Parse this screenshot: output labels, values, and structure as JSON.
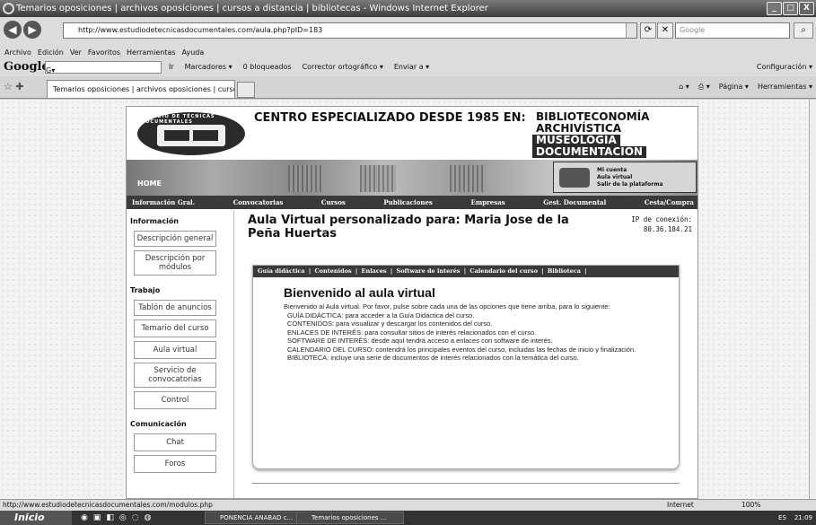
{
  "window": {
    "title": "Temarios oposiciones | archivos oposiciones | cursos a distancia | bibliotecas - Windows Internet Explorer",
    "btn_min": "_",
    "btn_max": "□",
    "btn_close": "X"
  },
  "address": {
    "url": "http://www.estudiodetecnicasdocumentales.com/aula.php?pID=183",
    "search_placeholder": "Google"
  },
  "menu": [
    "Archivo",
    "Edición",
    "Ver",
    "Favoritos",
    "Herramientas",
    "Ayuda"
  ],
  "google_toolbar": {
    "logo": "Google",
    "box_value": "G▾",
    "items": [
      "Ir",
      "Marcadores ▾",
      "0 bloqueados",
      "Corrector ortográfico ▾",
      "Enviar a ▾"
    ],
    "config": "Configuración ▾"
  },
  "tab": {
    "label": "Temarios oposiciones | archivos oposiciones | cursos a d..."
  },
  "ie_tools": [
    "Página ▾",
    "Herramientas ▾"
  ],
  "site": {
    "headline": "CENTRO ESPECIALIZADO DESDE 1985 EN:",
    "areas": [
      "BIBLIOTECONOMÍA",
      "ARCHIVÍSTICA",
      "MUSEOLOGÍA",
      "DOCUMENTACIÓN"
    ],
    "logo_text": "ESTUDIO DE TÉCNICAS DOCUMENTALES",
    "banner_home": "HOME",
    "account_links": [
      "Mi cuenta",
      "Aula virtual",
      "Salir de la plataforma"
    ],
    "nav": [
      "Información Gral.",
      "Convocatorias",
      "Cursos",
      "Publicaciones",
      "Empresas",
      "Gest. Documental",
      "Cesta/Compra"
    ]
  },
  "sidebar": {
    "sections": [
      {
        "title": "Información",
        "items": [
          "Descripción general",
          "Descripción por módulos"
        ]
      },
      {
        "title": "Trabajo",
        "items": [
          "Tablón de anuncios",
          "Temario del curso",
          "Aula virtual",
          "Servicio de convocatorias",
          "Control"
        ]
      },
      {
        "title": "Comunicación",
        "items": [
          "Chat",
          "Foros"
        ]
      }
    ]
  },
  "content": {
    "title": "Aula Virtual personalizado para: Maria Jose de la Peña Huertas",
    "ip_label": "IP de conexión:",
    "ip_value": "80.36.184.21",
    "tabs": [
      "Guía didáctica",
      "Contenidos",
      "Enlaces",
      "Software de interés",
      "Calendario del curso",
      "Biblioteca"
    ],
    "welcome_title": "Bienvenido al aula virtual",
    "intro": "Bienvenido al Aula virtual. Por favor, pulse sobre cada una de las opciones que tiene arriba, para lo siguiente:",
    "lines": [
      "GUÍA DIDÁCTICA: para acceder a la Guía Didáctica del curso.",
      "CONTENIDOS: para visualizar y descargar los contenidos del curso.",
      "ENLACES DE INTERÉS: para consultar sitios de interés relacionados con el curso.",
      "SOFTWARE DE INTERÉS: desde aquí tendrá acceso a enlaces con software de interés.",
      "CALENDARIO DEL CURSO: contendrá los principales eventos del curso, incluidas las fechas de inicio y finalización.",
      "BIBLIOTECA: incluye una serie de documentos de interés relacionados con la temática del curso."
    ]
  },
  "statusbar": {
    "url": "http://www.estudiodetecnicasdocumentales.com/modulos.php",
    "zone": "Internet",
    "zoom": "100%"
  },
  "taskbar": {
    "start": "Inicio",
    "tasks": [
      "PONENCIA ANABAD c...",
      "Temarios oposiciones ..."
    ],
    "lang": "ES",
    "clock": "21:09"
  }
}
